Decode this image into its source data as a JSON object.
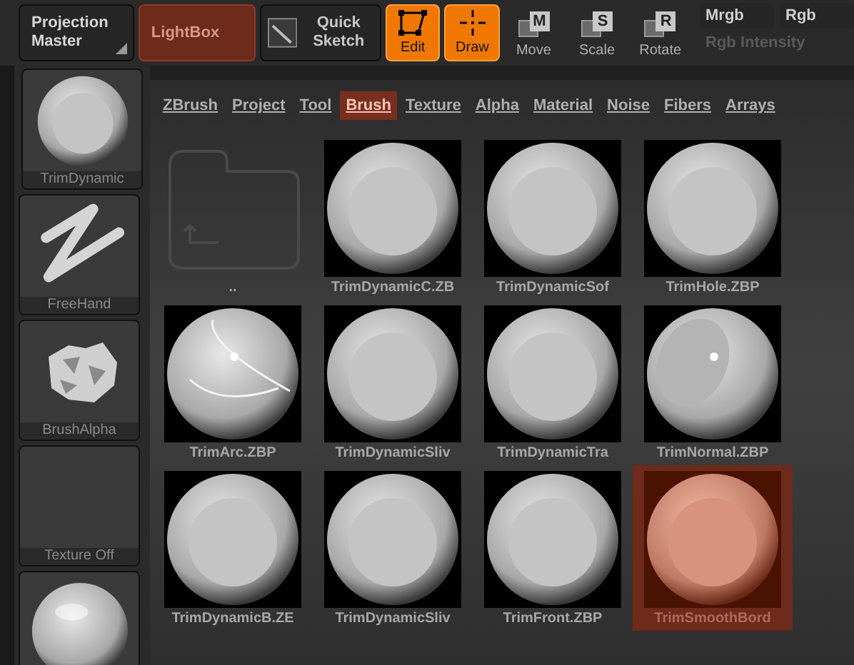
{
  "toolbar": [
    {
      "kind": "menu",
      "label": "Projection Master"
    },
    {
      "kind": "lightbox",
      "label": "LightBox",
      "selected": true
    },
    {
      "kind": "sketch",
      "label": "Quick Sketch"
    },
    {
      "kind": "edit",
      "label": "Edit",
      "selected": true
    },
    {
      "kind": "draw",
      "label": "Draw",
      "selected": true
    },
    {
      "kind": "transform",
      "key": "M",
      "label": "Move",
      "selected": false
    },
    {
      "kind": "transform",
      "key": "S",
      "label": "Scale",
      "selected": false
    },
    {
      "kind": "transform",
      "key": "R",
      "label": "Rotate",
      "selected": false
    }
  ],
  "color_modes": [
    {
      "label": "Mrgb"
    },
    {
      "label": "Rgb"
    }
  ],
  "intensity": {
    "label": "Rgb Intensity",
    "disabled": true
  },
  "sidebar": [
    {
      "kind": "sphere",
      "label": "TrimDynamic"
    },
    {
      "kind": "stroke",
      "label": "FreeHand"
    },
    {
      "kind": "alpha",
      "label": "BrushAlpha"
    },
    {
      "kind": "empty",
      "label": "Texture Off"
    },
    {
      "kind": "material"
    }
  ],
  "tabs": [
    {
      "label": "ZBrush",
      "selected": false
    },
    {
      "label": "Project",
      "selected": false
    },
    {
      "label": "Tool",
      "selected": false
    },
    {
      "label": "Brush",
      "selected": true
    },
    {
      "label": "Texture",
      "selected": false
    },
    {
      "label": "Alpha",
      "selected": false
    },
    {
      "label": "Material",
      "selected": false
    },
    {
      "label": "Noise",
      "selected": false
    },
    {
      "label": "Fibers",
      "selected": false
    },
    {
      "label": "Arrays",
      "selected": false
    }
  ],
  "items": [
    {
      "kind": "folder",
      "label": "..",
      "selected": false
    },
    {
      "kind": "sphere",
      "label": "TrimDynamicC.ZB",
      "selected": false
    },
    {
      "kind": "sphere",
      "label": "TrimDynamicSof",
      "selected": false
    },
    {
      "kind": "sphere",
      "label": "TrimHole.ZBP",
      "selected": false
    },
    {
      "kind": "arc",
      "label": "TrimArc.ZBP",
      "selected": false
    },
    {
      "kind": "sphere",
      "label": "TrimDynamicSliv",
      "selected": false
    },
    {
      "kind": "sphere",
      "label": "TrimDynamicTra",
      "selected": false
    },
    {
      "kind": "normal",
      "label": "TrimNormal.ZBP",
      "selected": false
    },
    {
      "kind": "sphere",
      "label": "TrimDynamicB.ZE",
      "selected": false
    },
    {
      "kind": "sphere",
      "label": "TrimDynamicSliv",
      "selected": false
    },
    {
      "kind": "sphere",
      "label": "TrimFront.ZBP",
      "selected": false
    },
    {
      "kind": "sphere",
      "label": "TrimSmoothBord",
      "selected": true
    }
  ]
}
